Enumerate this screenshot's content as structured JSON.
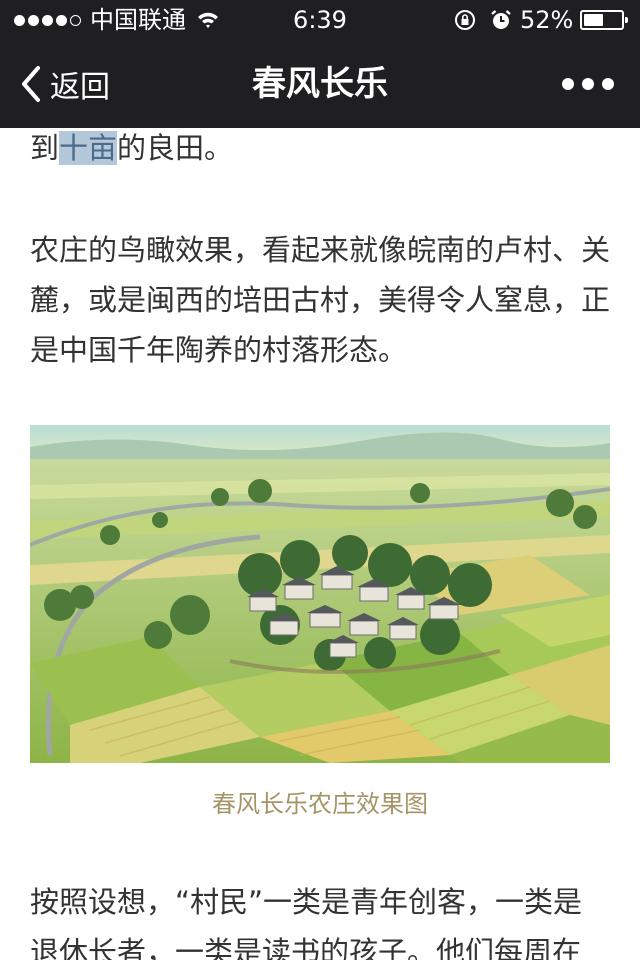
{
  "status_bar": {
    "carrier": "中国联通",
    "signal_bars_filled": 4,
    "signal_bars_total": 5,
    "time": "6:39",
    "battery_text": "52%",
    "battery_level": 0.52,
    "icons": [
      "signal-dots",
      "wifi-icon",
      "orientation-lock-icon",
      "alarm-icon",
      "battery-icon"
    ]
  },
  "nav": {
    "back_label": "返回",
    "title": "春风长乐",
    "more_icon": "more-dots-icon",
    "background": "#1f1f21"
  },
  "article": {
    "para1": {
      "before": "到",
      "highlight": "十亩",
      "after": "的良田。"
    },
    "para2": "农庄的鸟瞰效果，看起来就像皖南的卢村、关麓，或是闽西的培田古村，美得令人窒息，正是中国千年陶养的村落形态。",
    "figure_caption": "春风长乐农庄效果图",
    "para3": "按照设想，“村民”一类是青年创客，一类是退休长者，一类是读书的孩子。他们每周在"
  },
  "colors": {
    "body_text": "#333333",
    "caption": "#a59466",
    "highlight_bg": "#b5c8da",
    "highlight_text": "#4c6a8a"
  }
}
